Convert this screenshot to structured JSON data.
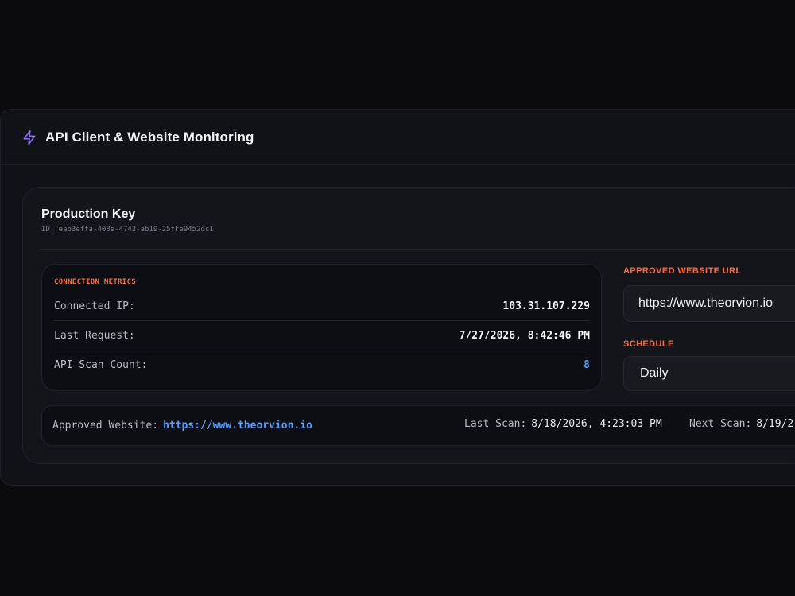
{
  "header": {
    "title": "API Client & Website Monitoring",
    "icon": "lightning-bolt-icon"
  },
  "key": {
    "name": "Production Key",
    "id_text": "ID: eab3effa-408e-4743-ab19-25ffe9452dc1"
  },
  "metrics": {
    "title": "CONNECTION METRICS",
    "rows": [
      {
        "label": "Connected IP:",
        "value": "103.31.107.229"
      },
      {
        "label": "Last Request:",
        "value": "7/27/2026, 8:42:46 PM"
      },
      {
        "label": "API Scan Count:",
        "value": "8"
      }
    ]
  },
  "settings": {
    "url_label": "APPROVED WEBSITE URL",
    "url_value": "https://www.theorvion.io",
    "schedule_label": "SCHEDULE",
    "schedule_value": "Daily"
  },
  "bottom": {
    "website_label": "Approved Website:",
    "website_link": "https://www.theorvion.io",
    "last_scan_label": "Last Scan:",
    "last_scan_value": "8/18/2026, 4:23:03 PM",
    "next_scan_label": "Next Scan:",
    "next_scan_value": "8/19/2"
  },
  "colors": {
    "accent_orange": "#ff6b3d",
    "link_blue": "#5b9cf5",
    "icon_purple": "#8b6cf2",
    "background": "#0b0b0d"
  }
}
